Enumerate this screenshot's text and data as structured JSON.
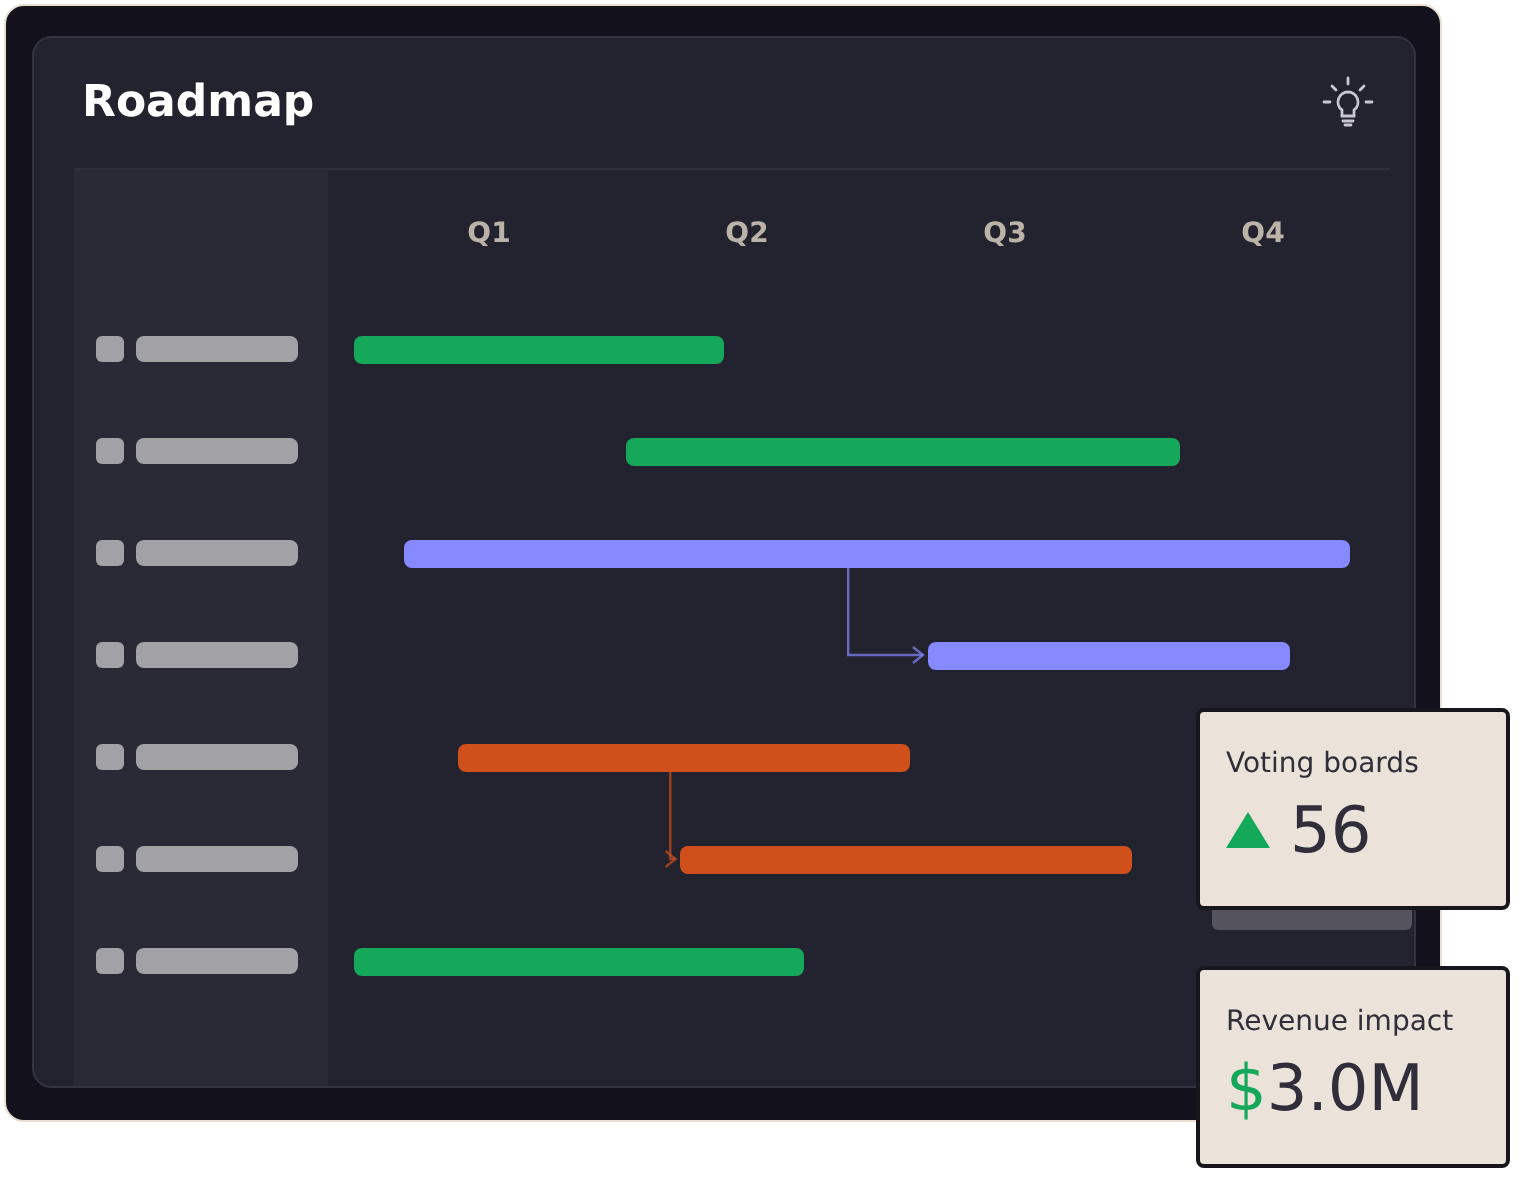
{
  "title": "Roadmap",
  "quarters": [
    "Q1",
    "Q2",
    "Q3",
    "Q4"
  ],
  "rows": [
    {
      "color": "#16a85a",
      "linked": false
    },
    {
      "color": "#16a85a",
      "linked": false
    },
    {
      "color": "#8689ff",
      "linked": false
    },
    {
      "color": "#8689ff",
      "linked": true
    },
    {
      "color": "#d0501c",
      "linked": false
    },
    {
      "color": "#d0501c",
      "linked": true
    },
    {
      "color": "#16a85a",
      "linked": false
    }
  ],
  "cards": [
    {
      "label": "Voting boards",
      "kind": "trend",
      "value": "56"
    },
    {
      "label": "Revenue impact",
      "kind": "money",
      "prefix": "$",
      "value": "3.0M"
    }
  ]
}
